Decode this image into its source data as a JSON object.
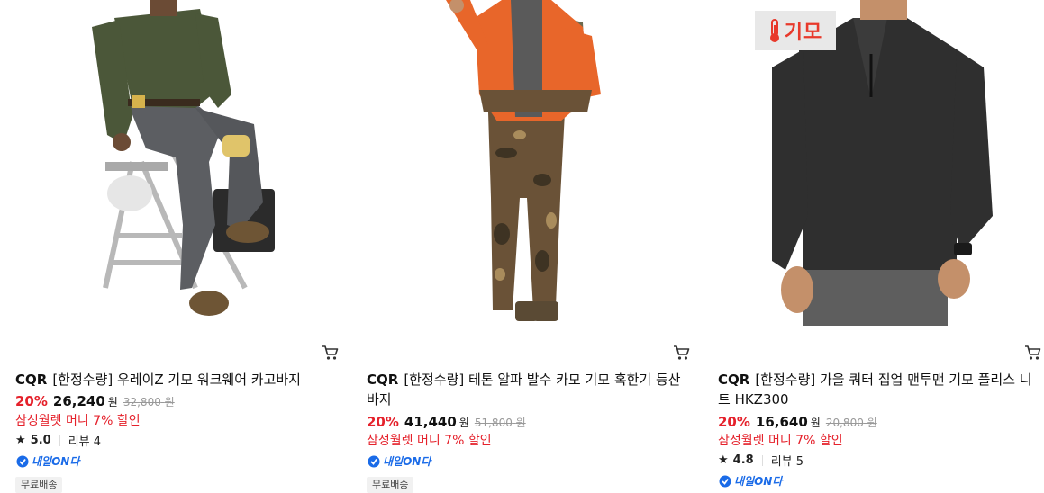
{
  "products": [
    {
      "brand": "CQR",
      "name": "[한정수량] 우레이Z 기모 워크웨어 카고바지",
      "discount": "20%",
      "price": "26,240",
      "won": "원",
      "original_price": "32,800",
      "original_won": "원",
      "promo": "삼성월렛 머니 7% 할인",
      "rating": "5.0",
      "reviews": "리뷰 4",
      "delivery": "내일ON다",
      "tag": "무료배송",
      "image": "man-in-olive-shirt-grey-cargo-pants-on-ladder"
    },
    {
      "brand": "CQR",
      "name": "[한정수량] 테톤 알파 발수 카모 기모 혹한기 등산바지",
      "discount": "20%",
      "price": "41,440",
      "won": "원",
      "original_price": "51,800",
      "original_won": "원",
      "promo": "삼성월렛 머니 7% 할인",
      "delivery": "내일ON다",
      "tag": "무료배송",
      "image": "man-in-orange-jacket-camo-pants"
    },
    {
      "brand": "CQR",
      "name": "[한정수량] 가을 쿼터 집업 맨투맨 기모 플리스 니트 HKZ300",
      "discount": "20%",
      "price": "16,640",
      "won": "원",
      "original_price": "20,800",
      "original_won": "원",
      "promo": "삼성월렛 머니 7% 할인",
      "rating": "4.8",
      "reviews": "리뷰 5",
      "delivery": "내일ON다",
      "badge": "기모",
      "image": "man-in-black-quarter-zip-fleece"
    }
  ],
  "colors": {
    "discount": "#e5212b",
    "delivery": "#1a6be8",
    "badge": "#e8392b"
  },
  "icons": {
    "cart": "cart-icon",
    "star": "star-icon",
    "delivery": "delivery-icon",
    "badge": "thermometer-icon"
  }
}
